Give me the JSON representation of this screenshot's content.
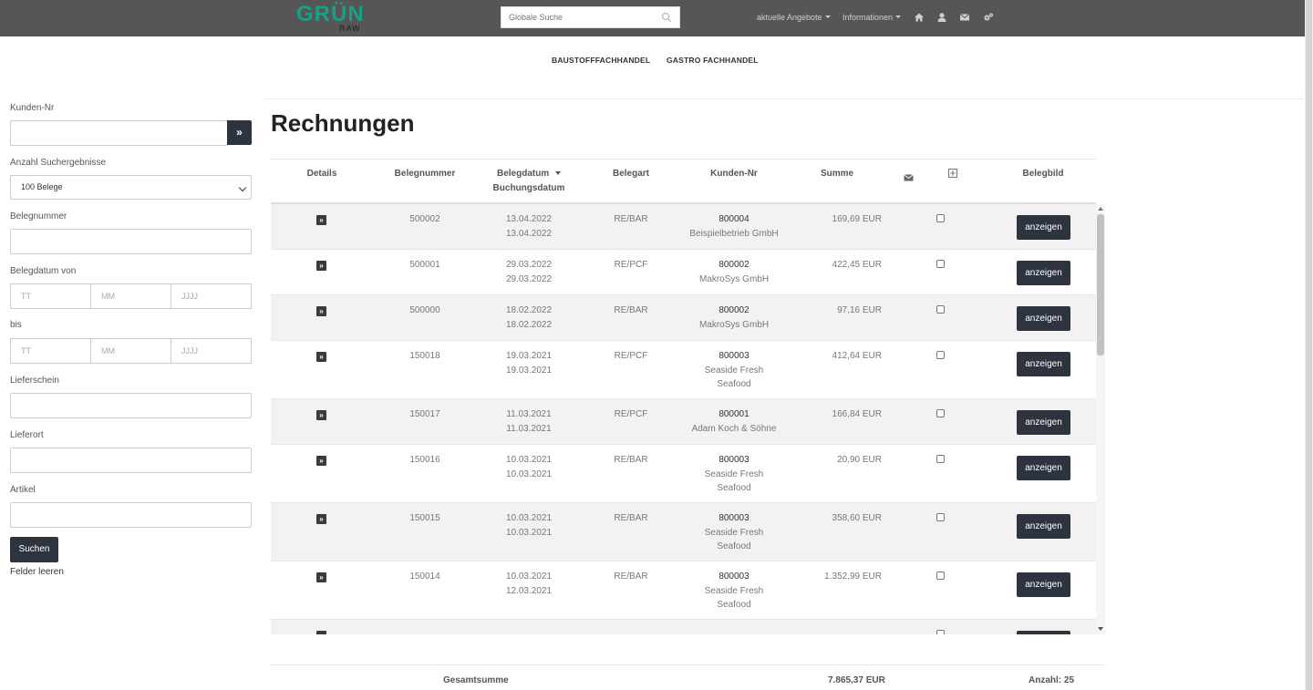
{
  "brand": {
    "logo_main": "GRÜN",
    "logo_sub": "RAW",
    "color": "#16a086"
  },
  "topbar": {
    "search_placeholder": "Globale Suche",
    "menu_offers": "aktuelle Angebote",
    "menu_info": "Informationen",
    "icons": [
      "home-icon",
      "user-icon",
      "envelope-icon",
      "cogs-icon"
    ]
  },
  "subnav": {
    "item1": "BAUSTOFFFACHHANDEL",
    "item2": "GASTRO FACHHANDEL"
  },
  "sidebar": {
    "kunden_nr_label": "Kunden-Nr",
    "kunden_nr_value": "",
    "count_label": "Anzahl Suchergebnisse",
    "count_value": "100 Belege",
    "belegnummer_label": "Belegnummer",
    "belegdatum_label": "Belegdatum von",
    "bis_label": "bis",
    "day_placeholder": "TT",
    "month_placeholder": "MM",
    "year_placeholder": "JJJJ",
    "lieferschein_label": "Lieferschein",
    "lieferort_label": "Lieferort",
    "artikel_label": "Artikel",
    "search_button": "Suchen",
    "clear_link": "Felder leeren"
  },
  "main": {
    "title": "Rechnungen",
    "columns": {
      "details": "Details",
      "belegnummer": "Belegnummer",
      "belegdatum": "Belegdatum",
      "buchungsdatum": "Buchungsdatum",
      "belegart": "Belegart",
      "kunden_nr": "Kunden-Nr",
      "summe": "Summe",
      "belegbild": "Belegbild"
    },
    "show_label": "anzeigen",
    "rows": [
      {
        "nr": "500002",
        "d1": "13.04.2022",
        "d2": "13.04.2022",
        "art": "RE/BAR",
        "knr": "800004",
        "name": "Beispielbetrieb GmbH",
        "summe": "169,69 EUR"
      },
      {
        "nr": "500001",
        "d1": "29.03.2022",
        "d2": "29.03.2022",
        "art": "RE/PCF",
        "knr": "800002",
        "name": "MakroSys GmbH",
        "summe": "422,45 EUR"
      },
      {
        "nr": "500000",
        "d1": "18.02.2022",
        "d2": "18.02.2022",
        "art": "RE/BAR",
        "knr": "800002",
        "name": "MakroSys GmbH",
        "summe": "97,16 EUR"
      },
      {
        "nr": "150018",
        "d1": "19.03.2021",
        "d2": "19.03.2021",
        "art": "RE/PCF",
        "knr": "800003",
        "name": "Seaside Fresh Seafood",
        "summe": "412,64 EUR"
      },
      {
        "nr": "150017",
        "d1": "11.03.2021",
        "d2": "11.03.2021",
        "art": "RE/PCF",
        "knr": "800001",
        "name": "Adam Koch & Söhne",
        "summe": "166,84 EUR"
      },
      {
        "nr": "150016",
        "d1": "10.03.2021",
        "d2": "10.03.2021",
        "art": "RE/BAR",
        "knr": "800003",
        "name": "Seaside Fresh Seafood",
        "summe": "20,90 EUR"
      },
      {
        "nr": "150015",
        "d1": "10.03.2021",
        "d2": "10.03.2021",
        "art": "RE/BAR",
        "knr": "800003",
        "name": "Seaside Fresh Seafood",
        "summe": "358,60 EUR"
      },
      {
        "nr": "150014",
        "d1": "10.03.2021",
        "d2": "12.03.2021",
        "art": "RE/BAR",
        "knr": "800003",
        "name": "Seaside Fresh Seafood",
        "summe": "1.352,99 EUR"
      }
    ],
    "footer": {
      "total_label": "Gesamtsumme",
      "total_value": "7.865,37 EUR",
      "count": "Anzahl: 25"
    }
  }
}
